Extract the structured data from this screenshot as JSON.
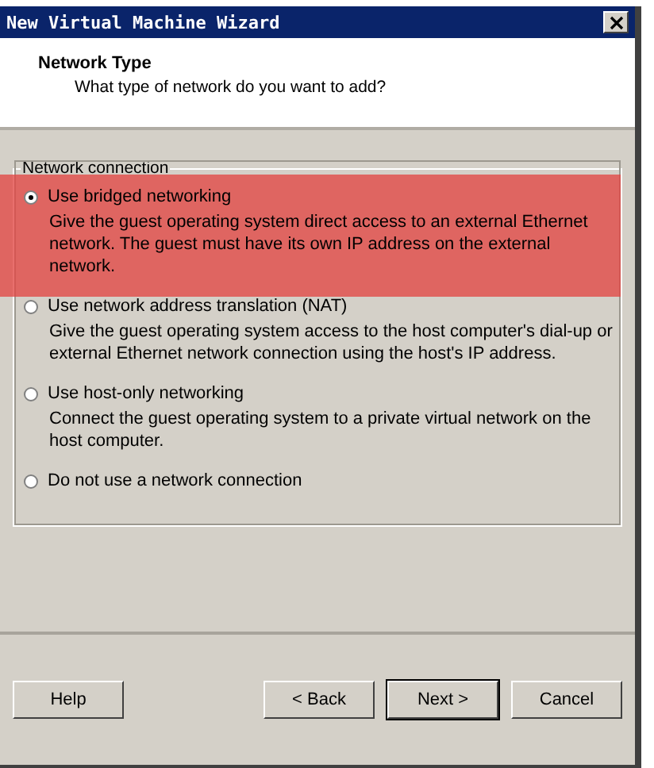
{
  "window": {
    "title": "New Virtual Machine Wizard"
  },
  "header": {
    "title": "Network Type",
    "subtitle": "What type of network do you want to add?"
  },
  "group": {
    "label": "Network connection",
    "options": [
      {
        "label": "Use bridged networking",
        "description": "Give the guest operating system direct access to an external Ethernet network. The guest must have its own IP address on the external network.",
        "selected": true,
        "highlighted": true
      },
      {
        "label": "Use network address translation (NAT)",
        "description": "Give the guest operating system access to the host computer's dial-up or external Ethernet network connection using the host's IP address.",
        "selected": false,
        "highlighted": false
      },
      {
        "label": "Use host-only networking",
        "description": "Connect the guest operating system to a private virtual network on the host computer.",
        "selected": false,
        "highlighted": false
      },
      {
        "label": "Do not use a network connection",
        "selected": false,
        "highlighted": false
      }
    ]
  },
  "buttons": [
    {
      "label": "Help",
      "kind": "left",
      "default": false
    },
    {
      "label": "< Back",
      "kind": "right",
      "default": false
    },
    {
      "label": "Next >",
      "kind": "right",
      "default": true
    },
    {
      "label": "Cancel",
      "kind": "right",
      "default": false
    }
  ]
}
